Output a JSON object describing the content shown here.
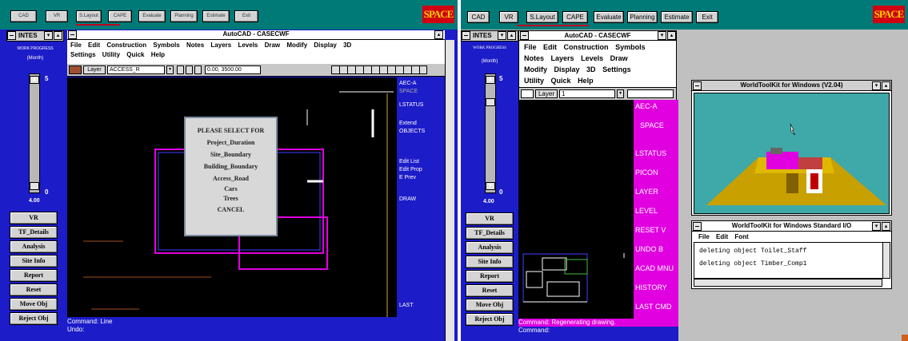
{
  "left": {
    "toolbar": [
      "CAD",
      "VR",
      "S.Layout",
      "CAPE",
      "Evaluate",
      "Planning",
      "Estimate",
      "Exit"
    ],
    "logo": "SPACE",
    "mdi_title": "INTES",
    "progress_label": "WORK PROGRESS",
    "period": "(Month)",
    "slider_top": "5",
    "slider_bottom": "0",
    "slider_value": "4.00",
    "side_buttons": [
      "VR",
      "TF_Details",
      "Analysis",
      "Site Info",
      "Report",
      "Reset",
      "Move Obj",
      "Reject Obj"
    ],
    "autocad_title": "AutoCAD - CASECWF",
    "menu_row1": [
      "File",
      "Edit",
      "Construction",
      "Symbols",
      "Notes",
      "Layers",
      "Levels",
      "Draw",
      "Modify",
      "Display",
      "3D"
    ],
    "menu_row2": [
      "Settings",
      "Utility",
      "Quick",
      "Help"
    ],
    "layer_label": "Layer",
    "layer_value": "ACCESS_R",
    "coords": "0.00, 3500.00",
    "dialog": [
      "PLEASE SELECT FOR",
      "Project_Duration",
      "Site_Boundary",
      "Building_Boundary",
      "Access_Road",
      "Cars",
      "Trees",
      "CANCEL"
    ],
    "side_menu": [
      "AEC-A",
      "SPACE",
      "LSTATUS",
      "Extend",
      "OBJECTS",
      "Edit List",
      "Edit Prop",
      "E Prev",
      "DRAW",
      "LAST"
    ],
    "command": [
      "Command: Line",
      "Undo:"
    ]
  },
  "right": {
    "toolbar": [
      "CAD",
      "VR",
      "S.Layout",
      "CAPE",
      "Evaluate",
      "Planning",
      "Estimate",
      "Exit"
    ],
    "logo": "SPACE",
    "mdi_title": "INTES",
    "progress_label": "WORK PROGRESS",
    "period": "(Month)",
    "slider_top": "5",
    "slider_bottom": "0",
    "slider_value": "4.00",
    "side_buttons": [
      "VR",
      "TF_Details",
      "Analysis",
      "Site Info",
      "Report",
      "Reset",
      "Move Obj",
      "Reject Obj"
    ],
    "autocad_title": "AutoCAD - CASECWF",
    "menu_rows": [
      [
        "File",
        "Edit",
        "Construction",
        "Symbols"
      ],
      [
        "Notes",
        "Layers",
        "Levels",
        "Draw"
      ],
      [
        "Modify",
        "Display",
        "3D",
        "Settings"
      ],
      [
        "Utility",
        "Quick",
        "Help"
      ]
    ],
    "layer_label": "Layer",
    "layer_value": "1",
    "side_menu": [
      "AEC-A",
      "SPACE",
      "LSTATUS",
      "PICON",
      "LAYER",
      "LEVEL",
      "RESET V",
      "UNDO B",
      "ACAD MNU",
      "HISTORY",
      "LAST CMD"
    ],
    "command": [
      "Command: Regenerating drawing.",
      "Command:"
    ],
    "wtk_title": "WorldToolKit for Windows (V2.04)",
    "io_title": "WorldToolKit for Windows Standard I/O",
    "io_menu": [
      "File",
      "Edit",
      "Font"
    ],
    "io_lines": [
      "deleting object Toilet_Staff",
      "deleting object Timber_Comp1"
    ]
  },
  "colors": {
    "accent_magenta": "#e000e0",
    "toolbar_teal": "#007a77",
    "panel_blue": "#1c1cc8",
    "logo_red": "#d00010"
  }
}
